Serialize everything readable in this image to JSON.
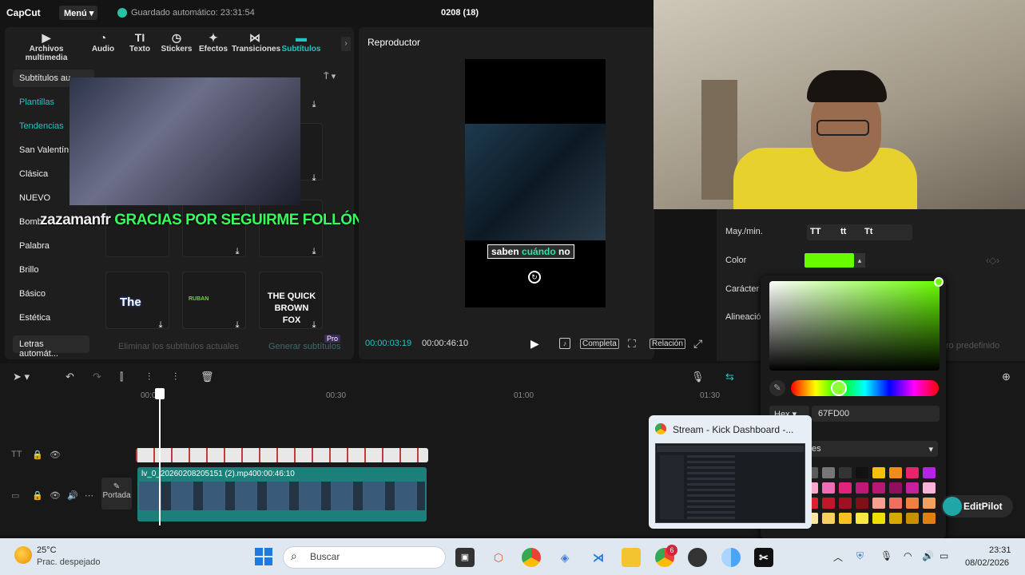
{
  "app": {
    "logo": "CapCut",
    "menu": "Menú",
    "autosave": "Guardado automático: 23:31:54",
    "project": "0208 (18)"
  },
  "toptabs": [
    {
      "icon": "▶",
      "label": "Archivos multimedia"
    },
    {
      "icon": "◔",
      "label": "Audio"
    },
    {
      "icon": "TI",
      "label": "Texto"
    },
    {
      "icon": "◷",
      "label": "Stickers"
    },
    {
      "icon": "✦",
      "label": "Efectos"
    },
    {
      "icon": "⋈",
      "label": "Transiciones"
    },
    {
      "icon": "▬",
      "label": "Subtítulos"
    }
  ],
  "library": {
    "header": "Subtítulos au",
    "categories": [
      "Plantillas",
      "Tendencias",
      "San Valentín",
      "Clásica",
      "NUEVO",
      "Bomb",
      "Palabra",
      "Brillo",
      "Básico",
      "Estética"
    ],
    "auto_lyrics": "Letras automát...",
    "delete_subs": "Eliminar los subtítulos actuales",
    "generate": "Generar subtítulos",
    "pro": "Pro",
    "tile_the": "The",
    "tile_quick": "THE QUICK BROWN FOX",
    "tile_small": "RUBAN"
  },
  "overlay": {
    "user": "zazamanfr",
    "message": "GRACIAS POR SEGUIRME FOLLÓN"
  },
  "player": {
    "title": "Reproductor",
    "subtitle_pre": "saben ",
    "subtitle_hl": "cuándo",
    "subtitle_post": " no",
    "time_current": "00:00:03:19",
    "time_total": "00:00:46:10",
    "full": "Completa",
    "ratio": "Relación"
  },
  "timeline": {
    "ticks": [
      "00:00",
      "00:30",
      "01:00",
      "01:30"
    ],
    "clip_name": "lv_0_20260208205151 (2).mp4",
    "clip_duration": "00:00:46:10",
    "cover": "Portada",
    "text_clip_label": "A"
  },
  "props": {
    "case_label": "May./min.",
    "case_opts": [
      "TT",
      "tt",
      "Tt"
    ],
    "color_label": "Color",
    "char_label": "Carácter",
    "align_label": "Alineació",
    "hex_mode": "Hex",
    "hex_value": "67FD00",
    "preset": "ro predefinido",
    "selected_color": "#67FD00"
  },
  "popup": {
    "title": "Stream - Kick Dashboard -..."
  },
  "editpilot": "EditPilot",
  "taskbar": {
    "temp": "25°C",
    "weather": "Prac. despejado",
    "search": "Buscar",
    "time": "23:31",
    "date": "08/02/2026",
    "badge": "6"
  }
}
